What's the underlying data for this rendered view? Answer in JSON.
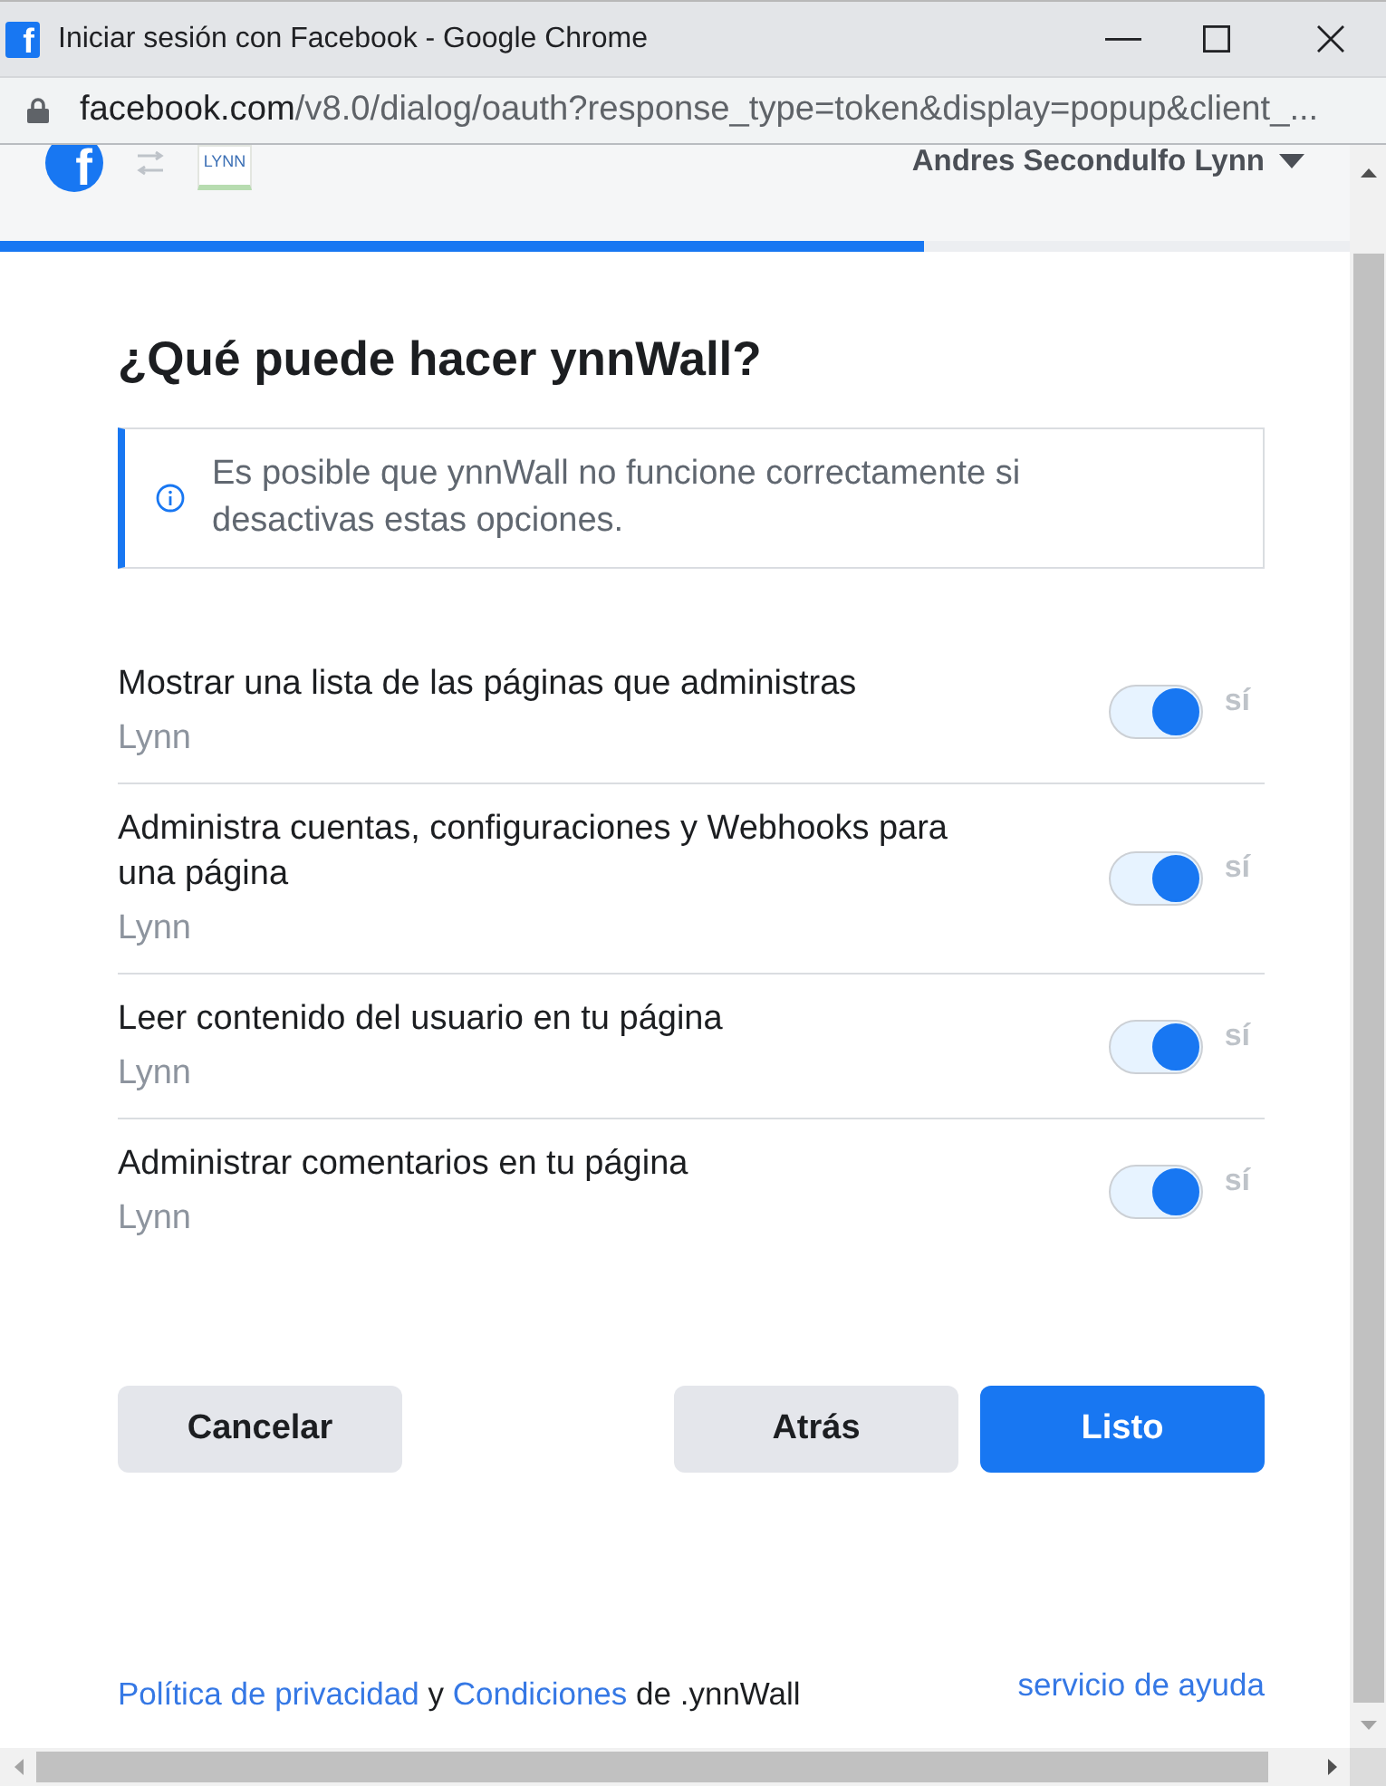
{
  "window": {
    "favicon_letter": "f",
    "title": "Iniciar sesión con Facebook - Google Chrome"
  },
  "address_bar": {
    "host": "facebook.com",
    "path": "/v8.0/dialog/oauth?response_type=token&display=popup&client_..."
  },
  "header": {
    "brand_letter": "f",
    "page_logo_text": "LYNN",
    "user_name": "Andres Secondulfo Lynn"
  },
  "progress": {
    "level": 0.685
  },
  "dialog": {
    "title": "¿Qué puede hacer ynnWall?",
    "notice": "Es posible que ynnWall no funcione correctamente si desactivas estas opciones."
  },
  "permissions": [
    {
      "title": "Mostrar una lista de las páginas que administras",
      "subtitle": "Lynn",
      "on": true,
      "state_label": "sí"
    },
    {
      "title": "Administra cuentas, configuraciones y Webhooks para una página",
      "subtitle": "Lynn",
      "on": true,
      "state_label": "sí"
    },
    {
      "title": "Leer contenido del usuario en tu página",
      "subtitle": "Lynn",
      "on": true,
      "state_label": "sí"
    },
    {
      "title": "Administrar comentarios en tu página",
      "subtitle": "Lynn",
      "on": true,
      "state_label": "sí"
    }
  ],
  "buttons": [
    {
      "label": "Cancelar",
      "kind": "secondary"
    },
    {
      "label": "Atrás",
      "kind": "secondary"
    },
    {
      "label": "Listo",
      "kind": "primary"
    }
  ],
  "footer": {
    "privacy_link": "Política de privacidad",
    "joiner": "y",
    "terms_link": "Condiciones",
    "suffix": "de .ynnWall",
    "help_link": "servicio de ayuda"
  }
}
